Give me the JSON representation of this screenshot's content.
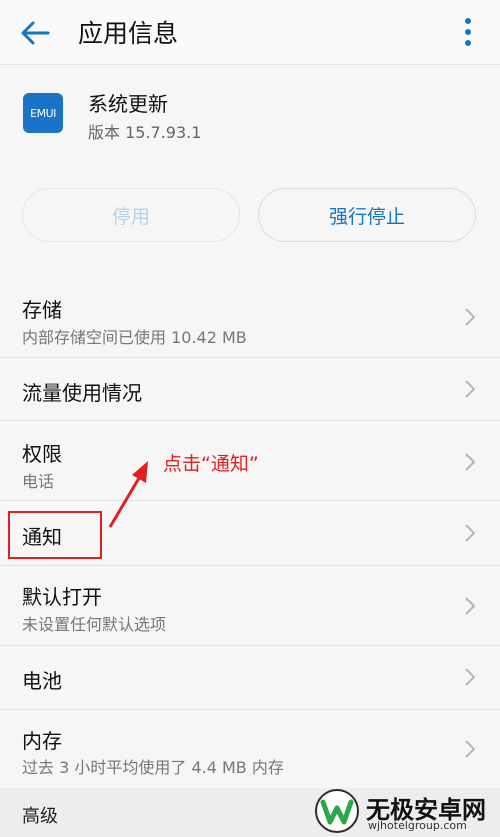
{
  "header": {
    "title": "应用信息",
    "back_icon": "arrow-left-icon",
    "more_icon": "more-vertical-icon"
  },
  "app": {
    "icon_text": "EMUI",
    "name": "系统更新",
    "version": "版本 15.7.93.1"
  },
  "buttons": {
    "disable": "停用",
    "force_stop": "强行停止"
  },
  "rows": [
    {
      "title": "存储",
      "subtitle": "内部存储空间已使用 10.42 MB"
    },
    {
      "title": "流量使用情况",
      "subtitle": ""
    },
    {
      "title": "权限",
      "subtitle": "电话"
    },
    {
      "title": "通知",
      "subtitle": ""
    },
    {
      "title": "默认打开",
      "subtitle": "未设置任何默认选项"
    },
    {
      "title": "电池",
      "subtitle": ""
    },
    {
      "title": "内存",
      "subtitle": "过去 3 小时平均使用了 4.4 MB 内存"
    }
  ],
  "section": {
    "advanced": "高级"
  },
  "annotation": {
    "text": "点击“通知”",
    "color": "#e02020"
  },
  "watermark": {
    "title": "无极安卓网",
    "url": "wjhotelgroup.com"
  },
  "colors": {
    "accent": "#1476c8",
    "disabled_text": "#b7d3ea"
  }
}
